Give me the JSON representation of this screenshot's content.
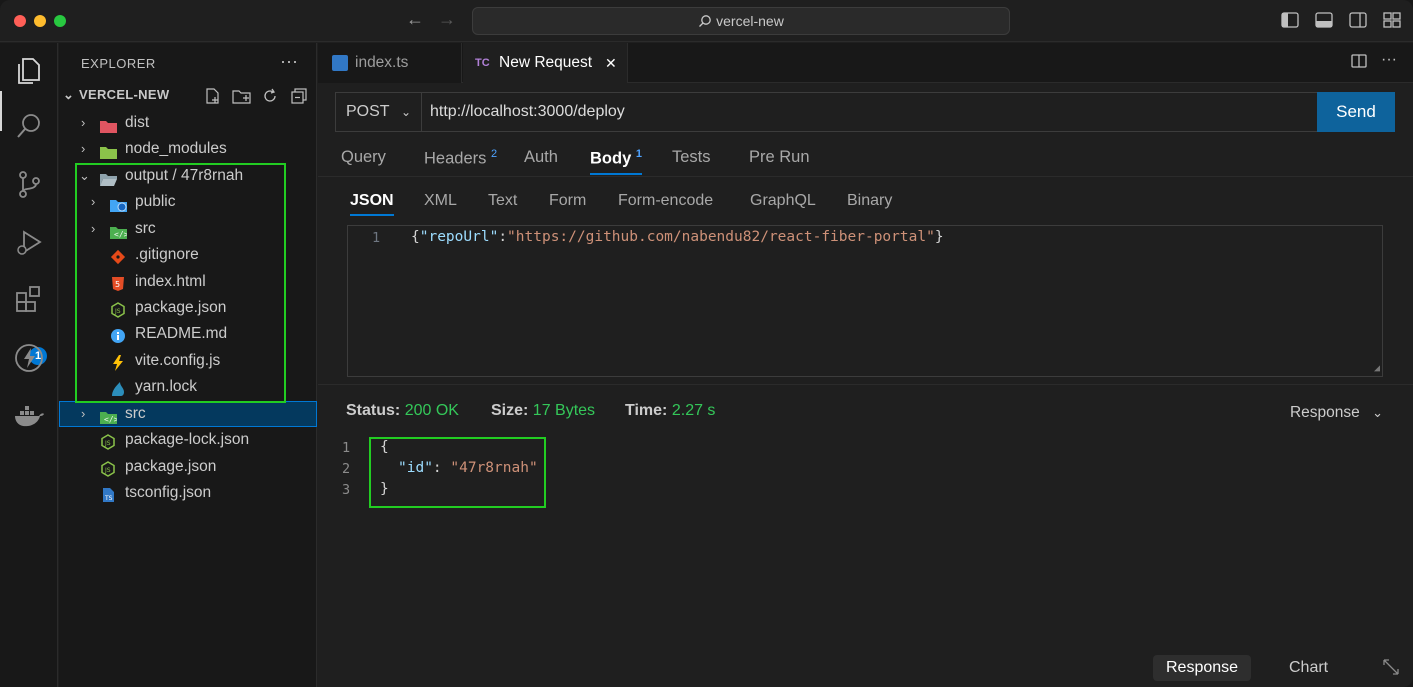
{
  "window": {
    "title": "vercel-new"
  },
  "sidebar": {
    "title": "EXPLORER",
    "more": "···",
    "root": "VERCEL-NEW",
    "items": [
      {
        "label": "dist",
        "kind": "folder",
        "icon": "folder-dist-icon",
        "color": "#e05561"
      },
      {
        "label": "node_modules",
        "kind": "folder",
        "icon": "folder-node-icon",
        "color": "#8bc34a"
      },
      {
        "label": "output",
        "suffix": "/ 47r8rnah",
        "kind": "folder-open",
        "icon": "folder-open-icon",
        "color": "#90a4ae"
      },
      {
        "label": "public",
        "kind": "folder",
        "icon": "folder-public-icon",
        "color": "#42a5f5"
      },
      {
        "label": "src",
        "kind": "folder",
        "icon": "folder-src-icon",
        "color": "#4caf50"
      },
      {
        "label": ".gitignore",
        "kind": "file",
        "icon": "git-icon",
        "color": "#e64a19"
      },
      {
        "label": "index.html",
        "kind": "file",
        "icon": "html5-icon",
        "color": "#e44d26"
      },
      {
        "label": "package.json",
        "kind": "file",
        "icon": "nodejs-icon",
        "color": "#8bc34a"
      },
      {
        "label": "README.md",
        "kind": "file",
        "icon": "info-icon",
        "color": "#42a5f5"
      },
      {
        "label": "vite.config.js",
        "kind": "file",
        "icon": "vite-icon",
        "color": "#ffc107"
      },
      {
        "label": "yarn.lock",
        "kind": "file",
        "icon": "yarn-icon",
        "color": "#2c8ebb"
      },
      {
        "label": "src",
        "kind": "folder",
        "icon": "folder-src-icon",
        "color": "#4caf50"
      },
      {
        "label": "package-lock.json",
        "kind": "file",
        "icon": "nodejs-icon",
        "color": "#8bc34a"
      },
      {
        "label": "package.json",
        "kind": "file",
        "icon": "nodejs-icon",
        "color": "#8bc34a"
      },
      {
        "label": "tsconfig.json",
        "kind": "file",
        "icon": "tsconfig-icon",
        "color": "#3178c6"
      }
    ]
  },
  "activity": {
    "extensions_badge": "1"
  },
  "tabs": [
    {
      "label": "index.ts",
      "icon": "typescript-icon"
    },
    {
      "label": "New Request",
      "icon": "thunder-client-icon",
      "icon_text": "TC",
      "close": "✕"
    }
  ],
  "request": {
    "method": "POST",
    "url": "http://localhost:3000/deploy",
    "send_label": "Send",
    "tabs": [
      {
        "label": "Query"
      },
      {
        "label": "Headers",
        "count": "2"
      },
      {
        "label": "Auth"
      },
      {
        "label": "Body",
        "count": "1"
      },
      {
        "label": "Tests"
      },
      {
        "label": "Pre Run"
      }
    ],
    "body_tabs": [
      "JSON",
      "XML",
      "Text",
      "Form",
      "Form-encode",
      "GraphQL",
      "Binary"
    ],
    "body": {
      "line_number": "1",
      "open": "{",
      "key": "\"repoUrl\"",
      "colon": ":",
      "value": "\"https://github.com/nabendu82/react-fiber-portal\"",
      "close": "}"
    }
  },
  "response": {
    "status_label": "Status:",
    "status_value": "200 OK",
    "size_label": "Size:",
    "size_value": "17 Bytes",
    "time_label": "Time:",
    "time_value": "2.27 s",
    "view_label": "Response",
    "lines": [
      {
        "n": "1",
        "text": "{"
      },
      {
        "n": "2",
        "key": "\"id\"",
        "colon": ": ",
        "value": "\"47r8rnah\""
      },
      {
        "n": "3",
        "text": "}"
      }
    ],
    "bottom_tabs": [
      "Response",
      "Chart"
    ]
  }
}
